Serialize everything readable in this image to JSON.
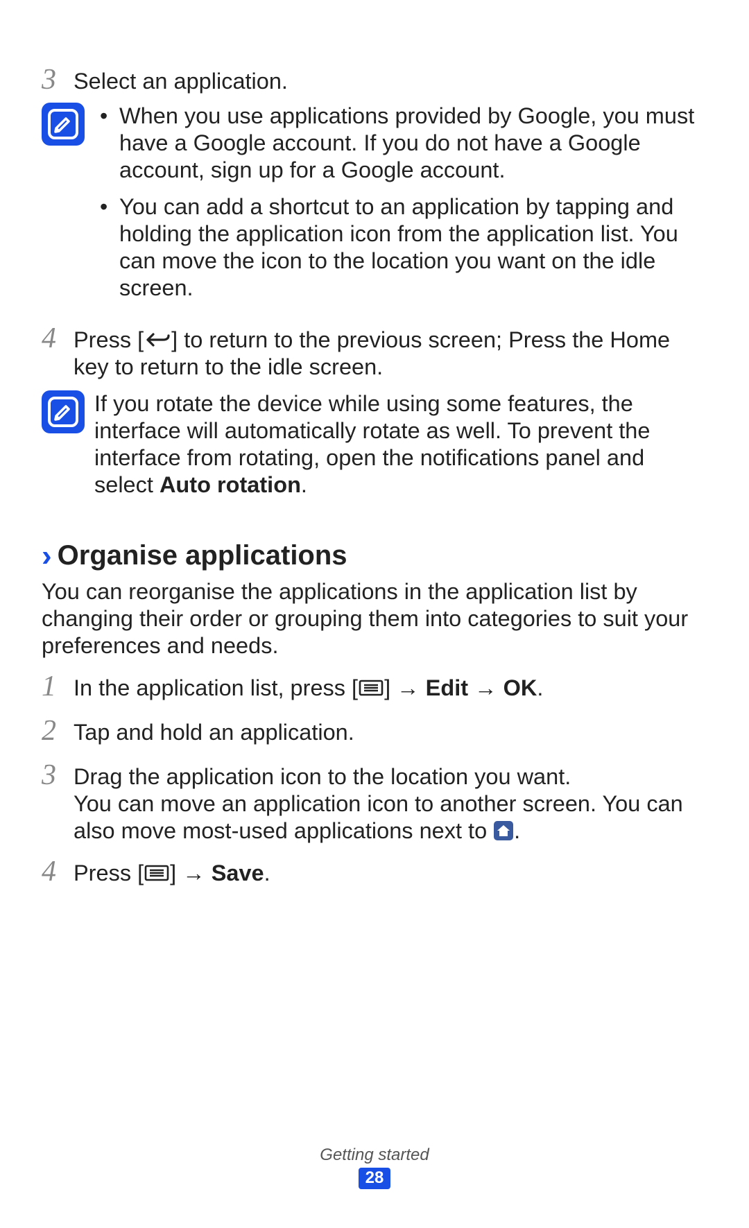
{
  "topSteps": {
    "step3": {
      "num": "3",
      "text": "Select an application."
    },
    "note1": {
      "bullets": [
        "When you use applications provided by Google, you must have a Google account. If you do not have a Google account, sign up for a Google account.",
        "You can add a shortcut to an application by tapping and holding the application icon from the application list. You can move the icon to the location you want on the idle screen."
      ]
    },
    "step4": {
      "num": "4",
      "text_a": "Press [",
      "text_b": "] to return to the previous screen; Press the Home key to return to the idle screen."
    },
    "note2": {
      "text_a": "If you rotate the device while using some features, the interface will automatically rotate as well. To prevent the interface from rotating, open the notifications panel and select ",
      "bold": "Auto rotation",
      "text_b": "."
    }
  },
  "organise": {
    "heading": "Organise applications",
    "intro": "You can reorganise the applications in the application list by changing their order or grouping them into categories to suit your preferences and needs.",
    "steps": {
      "s1": {
        "num": "1",
        "a": "In the application list, press [",
        "b": "] → ",
        "bold1": "Edit",
        "c": " → ",
        "bold2": "OK",
        "d": "."
      },
      "s2": {
        "num": "2",
        "text": "Tap and hold an application."
      },
      "s3": {
        "num": "3",
        "line1": "Drag the application icon to the location you want.",
        "line2a": "You can move an application icon to another screen. You can also move most-used applications next to ",
        "line2b": "."
      },
      "s4": {
        "num": "4",
        "a": "Press [",
        "b": "] → ",
        "bold": "Save",
        "c": "."
      }
    }
  },
  "footer": {
    "section": "Getting started",
    "page": "28"
  },
  "icons": {
    "note": "note-icon",
    "back": "back-key-icon",
    "menu": "menu-key-icon",
    "home": "home-app-icon"
  }
}
